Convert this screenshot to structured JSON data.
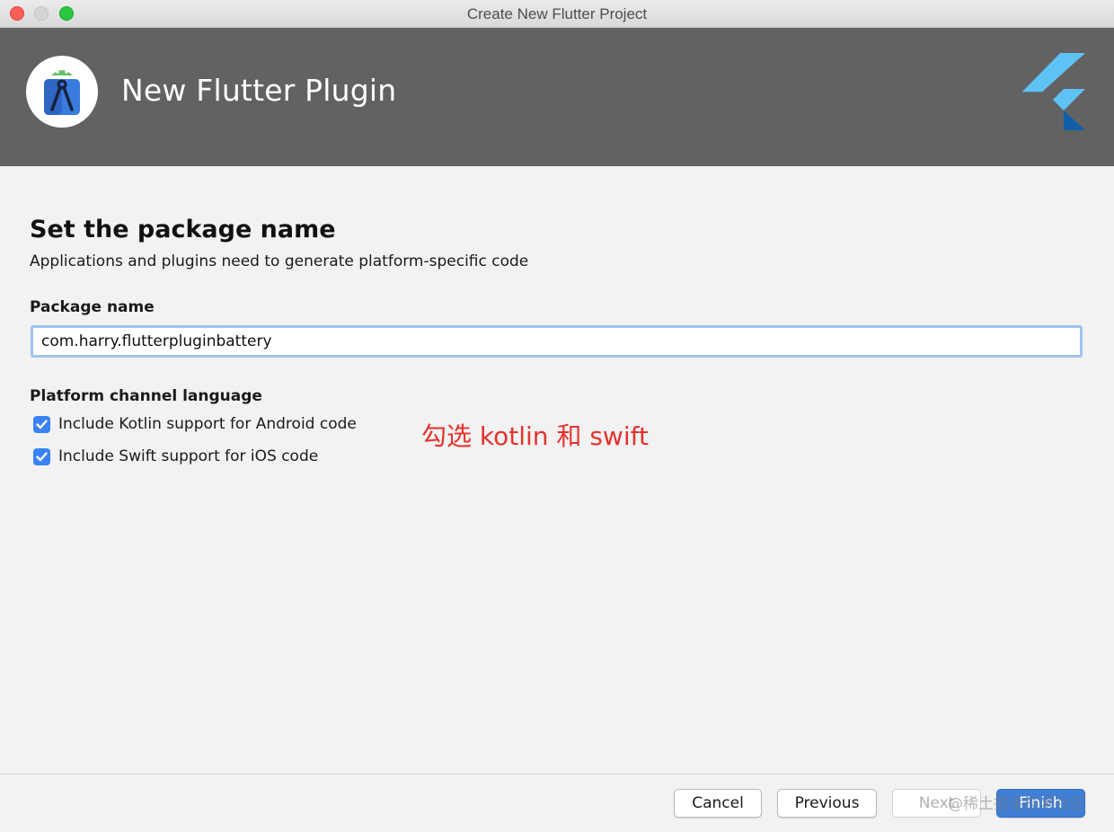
{
  "window": {
    "title": "Create New Flutter Project"
  },
  "banner": {
    "title": "New Flutter Plugin",
    "logo_icon": "android-studio-icon",
    "brand_icon": "flutter-logo-icon",
    "background_color": "#626262"
  },
  "content": {
    "heading": "Set the package name",
    "subheading": "Applications and plugins need to generate platform-specific code",
    "package_label": "Package name",
    "package_value": "com.harry.flutterpluginbattery",
    "platform_label": "Platform channel language",
    "checkboxes": [
      {
        "label": "Include Kotlin support for Android code",
        "checked": true
      },
      {
        "label": "Include Swift support for iOS code",
        "checked": true
      }
    ],
    "annotation": "勾选 kotlin 和 swift",
    "annotation_color": "#e5322d"
  },
  "footer": {
    "cancel_label": "Cancel",
    "previous_label": "Previous",
    "next_label": "Next",
    "finish_label": "Finish",
    "watermark": "@稀土掘金技术社区",
    "accent_color": "#3f7fd6"
  }
}
